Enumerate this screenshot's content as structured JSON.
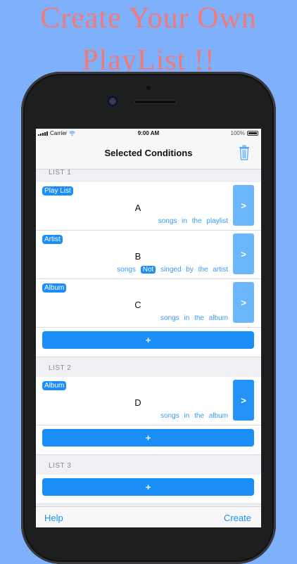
{
  "headline": {
    "line1": "Create Your Own",
    "line2": "PlayList !!"
  },
  "status_bar": {
    "carrier": "Carrier",
    "time": "9:00 AM",
    "battery": "100%"
  },
  "nav": {
    "title": "Selected Conditions",
    "trash_icon": "trash-icon"
  },
  "lists": [
    {
      "header": "LIST 1",
      "rows": [
        {
          "tag": "Play List",
          "value": "A",
          "desc_before": "songs in the playlist",
          "not": "",
          "desc_after": "",
          "arrow": ">"
        },
        {
          "tag": "Artist",
          "value": "B",
          "desc_before": "songs",
          "not": "Not",
          "desc_after": "singed by the artist",
          "arrow": ">"
        },
        {
          "tag": "Album",
          "value": "C",
          "desc_before": "songs in the album",
          "not": "",
          "desc_after": "",
          "arrow": ">"
        }
      ],
      "add_label": "+"
    },
    {
      "header": "LIST 2",
      "rows": [
        {
          "tag": "Album",
          "value": "D",
          "desc_before": "songs in the album",
          "not": "",
          "desc_after": "",
          "arrow": ">"
        }
      ],
      "add_label": "+"
    },
    {
      "header": "LIST 3",
      "rows": [],
      "add_label": "+"
    }
  ],
  "toolbar": {
    "help": "Help",
    "create": "Create"
  },
  "colors": {
    "accent": "#1b8ef7",
    "arrow_light": "#6cb6fb",
    "headline": "#f07a7a",
    "background": "#7fb0fb"
  }
}
